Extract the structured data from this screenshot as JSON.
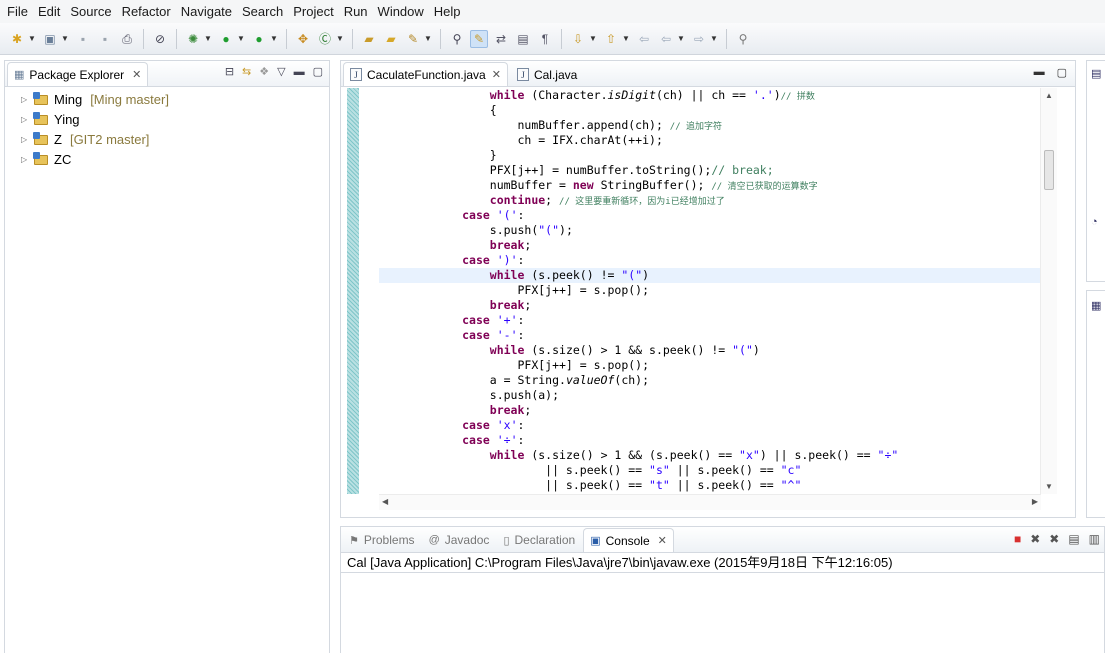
{
  "menu": [
    "File",
    "Edit",
    "Source",
    "Refactor",
    "Navigate",
    "Search",
    "Project",
    "Run",
    "Window",
    "Help"
  ],
  "explorer": {
    "tab_label": "Package Explorer",
    "projects": [
      {
        "name": "Ming",
        "branch": "[Ming master]"
      },
      {
        "name": "Ying",
        "branch": ""
      },
      {
        "name": "Z",
        "branch": "[GIT2 master]"
      },
      {
        "name": "ZC",
        "branch": ""
      }
    ]
  },
  "editor": {
    "tabs": [
      {
        "label": "CaculateFunction.java",
        "active": true
      },
      {
        "label": "Cal.java",
        "active": false
      }
    ]
  },
  "code_lines": [
    "                while (Character.isDigit(ch) || ch == '.')// 拼数",
    "                {",
    "                    numBuffer.append(ch); // 追加字符",
    "                    ch = IFX.charAt(++i);",
    "                }",
    "                PFX[j++] = numBuffer.toString();// break;",
    "                numBuffer = new StringBuffer(); // 清空已获取的运算数字",
    "                continue; // 这里要重新循环，因为i已经增加过了",
    "            case '(':",
    "                s.push(\"(\");",
    "                break;",
    "            case ')':",
    "                while (s.peek() != \"(\")",
    "                    PFX[j++] = s.pop();",
    "                break;",
    "            case '+':",
    "            case '-':",
    "                while (s.size() > 1 && s.peek() != \"(\")",
    "                    PFX[j++] = s.pop();",
    "                a = String.valueOf(ch);",
    "                s.push(a);",
    "                break;",
    "            case 'x':",
    "            case '÷':",
    "                while (s.size() > 1 && (s.peek() == \"x\") || s.peek() == \"÷\"",
    "                        || s.peek() == \"s\" || s.peek() == \"c\"",
    "                        || s.peek() == \"t\" || s.peek() == \"^\""
  ],
  "console": {
    "tabs": [
      {
        "label": "Problems",
        "icon": "problems-icon"
      },
      {
        "label": "Javadoc",
        "icon": "javadoc-icon"
      },
      {
        "label": "Declaration",
        "icon": "declaration-icon"
      },
      {
        "label": "Console",
        "icon": "console-icon"
      }
    ],
    "status": "Cal [Java Application] C:\\Program Files\\Java\\jre7\\bin\\javaw.exe (2015年9月18日 下午12:16:05)"
  },
  "colors": {
    "keyword": "#7f0055",
    "string": "#2a00ff",
    "comment": "#3f7f5f",
    "current_line": "#e8f2fe"
  }
}
